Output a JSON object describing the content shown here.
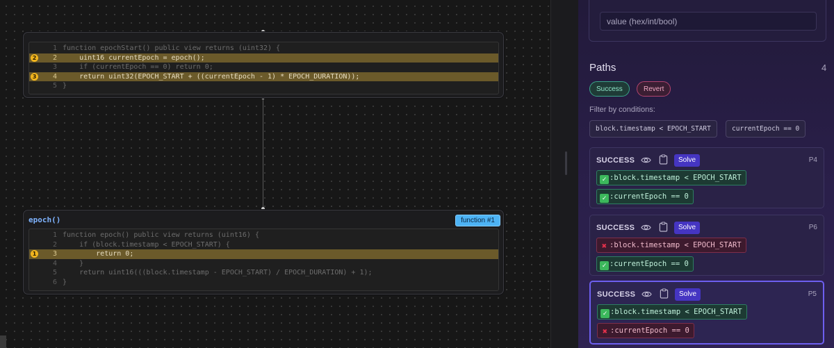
{
  "canvas": {
    "node_top": {
      "title": "",
      "lines": [
        {
          "n": "1",
          "code": "function epochStart() public view returns (uint32) {",
          "hl": false,
          "marker": ""
        },
        {
          "n": "2",
          "code": "    uint16 currentEpoch = epoch();",
          "hl": true,
          "marker": "2"
        },
        {
          "n": "3",
          "code": "    if (currentEpoch == 0) return 0;",
          "hl": false,
          "marker": ""
        },
        {
          "n": "4",
          "code": "    return uint32(EPOCH_START + ((currentEpoch - 1) * EPOCH_DURATION));",
          "hl": true,
          "marker": "3"
        },
        {
          "n": "5",
          "code": "}",
          "hl": false,
          "marker": ""
        }
      ]
    },
    "node_bottom": {
      "title": "epoch()",
      "badge": "function #1",
      "lines": [
        {
          "n": "1",
          "code": "function epoch() public view returns (uint16) {",
          "hl": false,
          "marker": ""
        },
        {
          "n": "2",
          "code": "    if (block.timestamp < EPOCH_START) {",
          "hl": false,
          "marker": ""
        },
        {
          "n": "3",
          "code": "        return 0;",
          "hl": true,
          "marker": "1"
        },
        {
          "n": "4",
          "code": "    }",
          "hl": false,
          "marker": ""
        },
        {
          "n": "5",
          "code": "    return uint16(((block.timestamp - EPOCH_START) / EPOCH_DURATION) + 1);",
          "hl": false,
          "marker": ""
        },
        {
          "n": "6",
          "code": "}",
          "hl": false,
          "marker": ""
        }
      ]
    }
  },
  "panel": {
    "value_placeholder": "value (hex/int/bool)",
    "paths_title": "Paths",
    "paths_count": "4",
    "toggle_success": "Success",
    "toggle_revert": "Revert",
    "filter_label": "Filter by conditions:",
    "filters": [
      "block.timestamp < EPOCH_START",
      "currentEpoch == 0"
    ],
    "paths": [
      {
        "status": "SUCCESS",
        "solve": "Solve",
        "id": "P4",
        "selected": false,
        "conds": [
          {
            "ok": true,
            "text": ":block.timestamp < EPOCH_START"
          },
          {
            "ok": true,
            "text": ":currentEpoch == 0"
          }
        ]
      },
      {
        "status": "SUCCESS",
        "solve": "Solve",
        "id": "P6",
        "selected": false,
        "conds": [
          {
            "ok": false,
            "text": ":block.timestamp < EPOCH_START"
          },
          {
            "ok": true,
            "text": ":currentEpoch == 0"
          }
        ]
      },
      {
        "status": "SUCCESS",
        "solve": "Solve",
        "id": "P5",
        "selected": true,
        "conds": [
          {
            "ok": true,
            "text": ":block.timestamp < EPOCH_START"
          },
          {
            "ok": false,
            "text": ":currentEpoch == 0"
          }
        ]
      }
    ]
  }
}
